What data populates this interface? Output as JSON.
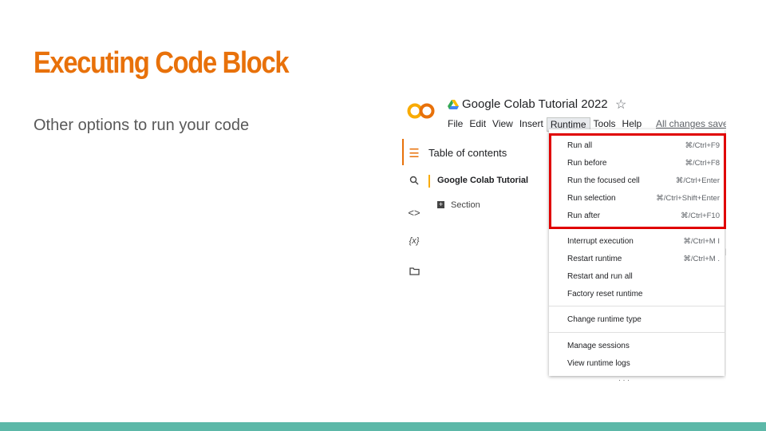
{
  "slide": {
    "title": "Executing Code Block",
    "subtitle": "Other options to run your code"
  },
  "colab": {
    "logo_text": "CO",
    "doc_title": "Google Colab Tutorial 2022",
    "menubar": [
      "File",
      "Edit",
      "View",
      "Insert",
      "Runtime",
      "Tools",
      "Help"
    ],
    "saved_status": "All changes saved",
    "sidebar": {
      "toc_title": "Table of contents",
      "toc_item": "Google Colab Tutorial",
      "toc_section": "Section",
      "icons": [
        "toc-icon",
        "search-icon",
        "code-icon",
        "variables-icon",
        "folder-icon"
      ]
    },
    "runtime_menu": {
      "group1": [
        {
          "label": "Run all",
          "shortcut": "⌘/Ctrl+F9"
        },
        {
          "label": "Run before",
          "shortcut": "⌘/Ctrl+F8"
        },
        {
          "label": "Run the focused cell",
          "shortcut": "⌘/Ctrl+Enter"
        },
        {
          "label": "Run selection",
          "shortcut": "⌘/Ctrl+Shift+Enter"
        },
        {
          "label": "Run after",
          "shortcut": "⌘/Ctrl+F10"
        }
      ],
      "group2": [
        {
          "label": "Interrupt execution",
          "shortcut": "⌘/Ctrl+M I"
        },
        {
          "label": "Restart runtime",
          "shortcut": "⌘/Ctrl+M ."
        },
        {
          "label": "Restart and run all",
          "shortcut": ""
        },
        {
          "label": "Factory reset runtime",
          "shortcut": ""
        }
      ],
      "group3": [
        {
          "label": "Change runtime type",
          "shortcut": ""
        }
      ],
      "group4": [
        {
          "label": "Manage sessions",
          "shortcut": ""
        },
        {
          "label": "View runtime logs",
          "shortcut": ""
        }
      ]
    },
    "highlight_color": "#e00000",
    "accent_color": "#e8710a"
  }
}
